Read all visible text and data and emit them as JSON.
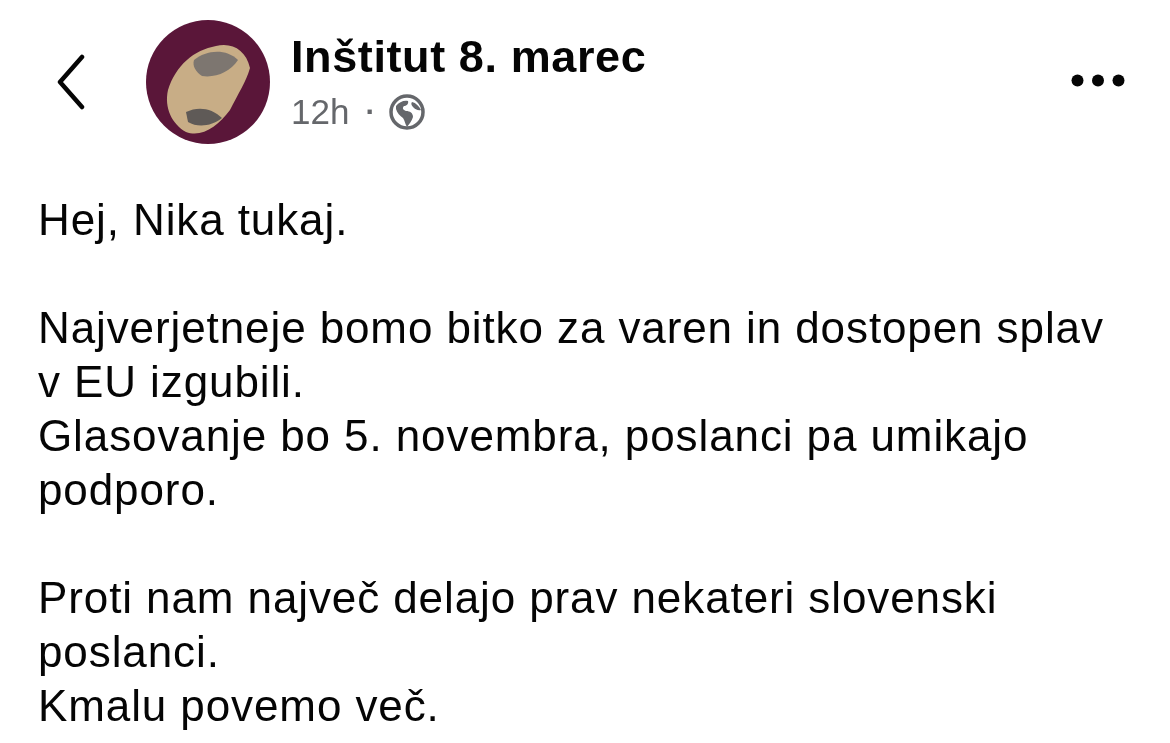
{
  "header": {
    "author": "Inštitut 8. marec",
    "time": "12h",
    "separator": "·"
  },
  "post": {
    "paragraphs": [
      [
        "Hej, Nika tukaj."
      ],
      [
        "Najverjetneje bomo bitko za varen in dostopen splav v EU izgubili.",
        "Glasovanje bo 5. novembra, poslanci pa umikajo podporo."
      ],
      [
        "Proti nam največ delajo prav nekateri slovenski poslanci.",
        "Kmalu povemo več."
      ]
    ]
  }
}
